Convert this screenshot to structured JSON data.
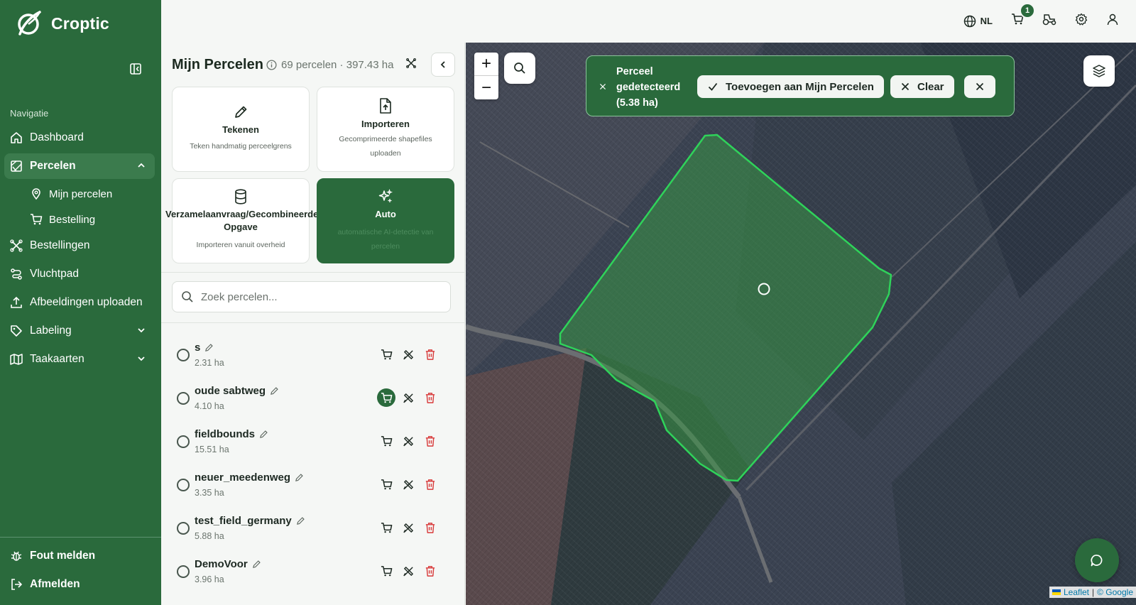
{
  "app": {
    "name": "Croptic"
  },
  "sidebar": {
    "heading": "Navigatie",
    "items": [
      {
        "label": "Dashboard",
        "icon": "home-icon"
      },
      {
        "label": "Percelen",
        "icon": "map-field-icon",
        "active": true,
        "expanded": true
      },
      {
        "label": "Bestellingen",
        "icon": "drone-icon"
      },
      {
        "label": "Vluchtpad",
        "icon": "route-icon"
      },
      {
        "label": "Afbeeldingen uploaden",
        "icon": "upload-icon"
      },
      {
        "label": "Labeling",
        "icon": "tag-icon"
      },
      {
        "label": "Taakaarten",
        "icon": "map-icon"
      }
    ],
    "sub_items": [
      {
        "label": "Mijn percelen",
        "icon": "map-pin-icon"
      },
      {
        "label": "Bestelling",
        "icon": "cart-icon"
      }
    ],
    "bottom": [
      {
        "label": "Fout melden",
        "icon": "bug-icon"
      },
      {
        "label": "Afmelden",
        "icon": "logout-icon"
      }
    ]
  },
  "topbar": {
    "language": "NL",
    "cart_count": "1"
  },
  "panel": {
    "title": "Mijn Percelen",
    "meta": "69 percelen · 397.43 ha",
    "cards": [
      {
        "title": "Tekenen",
        "subtitle": "Teken handmatig perceelgrens",
        "icon": "pencil-icon"
      },
      {
        "title": "Importeren",
        "subtitle": "Gecomprimeerde shapefiles uploaden",
        "icon": "file-upload-icon"
      },
      {
        "title": "Verzamelaanvraag/Gecombineerde Opgave",
        "subtitle": "Importeren vanuit overheid",
        "icon": "database-icon"
      },
      {
        "title": "Auto",
        "subtitle": "automatische AI-detectie van percelen",
        "icon": "sparkles-icon"
      }
    ],
    "search_placeholder": "Zoek percelen...",
    "fields": [
      {
        "name": "s",
        "area": "2.31 ha",
        "cart_active": false
      },
      {
        "name": "oude sabtweg",
        "area": "4.10 ha",
        "cart_active": true
      },
      {
        "name": "fieldbounds",
        "area": "15.51 ha",
        "cart_active": false
      },
      {
        "name": "neuer_meedenweg",
        "area": "3.35 ha",
        "cart_active": false
      },
      {
        "name": "test_field_germany",
        "area": "5.88 ha",
        "cart_active": false
      },
      {
        "name": "DemoVoor",
        "area": "3.96 ha",
        "cart_active": false
      }
    ]
  },
  "map": {
    "detection": {
      "text": "Perceel gedetecteerd (5.38 ha)",
      "add_label": "Toevoegen aan Mijn Percelen",
      "clear_label": "Clear"
    },
    "zoom_in": "+",
    "zoom_out": "−",
    "attribution": {
      "leaflet": "Leaflet",
      "separator": "|",
      "google": "© Google"
    },
    "colors": {
      "field_outline": "#2fd35a",
      "brand_green": "#2a6a3c"
    }
  }
}
